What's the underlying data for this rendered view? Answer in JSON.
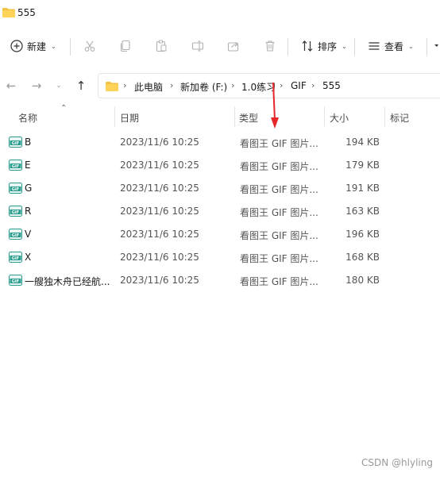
{
  "window": {
    "title": "555"
  },
  "toolbar": {
    "new_label": "新建",
    "sort_label": "排序",
    "view_label": "查看"
  },
  "breadcrumb": [
    "此电脑",
    "新加卷 (F:)",
    "1.0练习",
    "GIF",
    "555"
  ],
  "columns": {
    "name": "名称",
    "date": "日期",
    "type": "类型",
    "size": "大小",
    "tag": "标记"
  },
  "files": [
    {
      "name": "B",
      "date": "2023/11/6 10:25",
      "type": "看图王 GIF 图片...",
      "size": "194 KB"
    },
    {
      "name": "E",
      "date": "2023/11/6 10:25",
      "type": "看图王 GIF 图片...",
      "size": "179 KB"
    },
    {
      "name": "G",
      "date": "2023/11/6 10:25",
      "type": "看图王 GIF 图片...",
      "size": "191 KB"
    },
    {
      "name": "R",
      "date": "2023/11/6 10:25",
      "type": "看图王 GIF 图片...",
      "size": "163 KB"
    },
    {
      "name": "V",
      "date": "2023/11/6 10:25",
      "type": "看图王 GIF 图片...",
      "size": "196 KB"
    },
    {
      "name": "X",
      "date": "2023/11/6 10:25",
      "type": "看图王 GIF 图片...",
      "size": "168 KB"
    },
    {
      "name": "一艘独木舟已经航...",
      "date": "2023/11/6 10:25",
      "type": "看图王 GIF 图片...",
      "size": "180 KB"
    }
  ],
  "file_icon_text": "GIF",
  "watermark": "CSDN @hlyling",
  "colors": {
    "folder": "#f4c143",
    "gif_icon": "#2a9d8f",
    "annotation": "#e8262a"
  }
}
